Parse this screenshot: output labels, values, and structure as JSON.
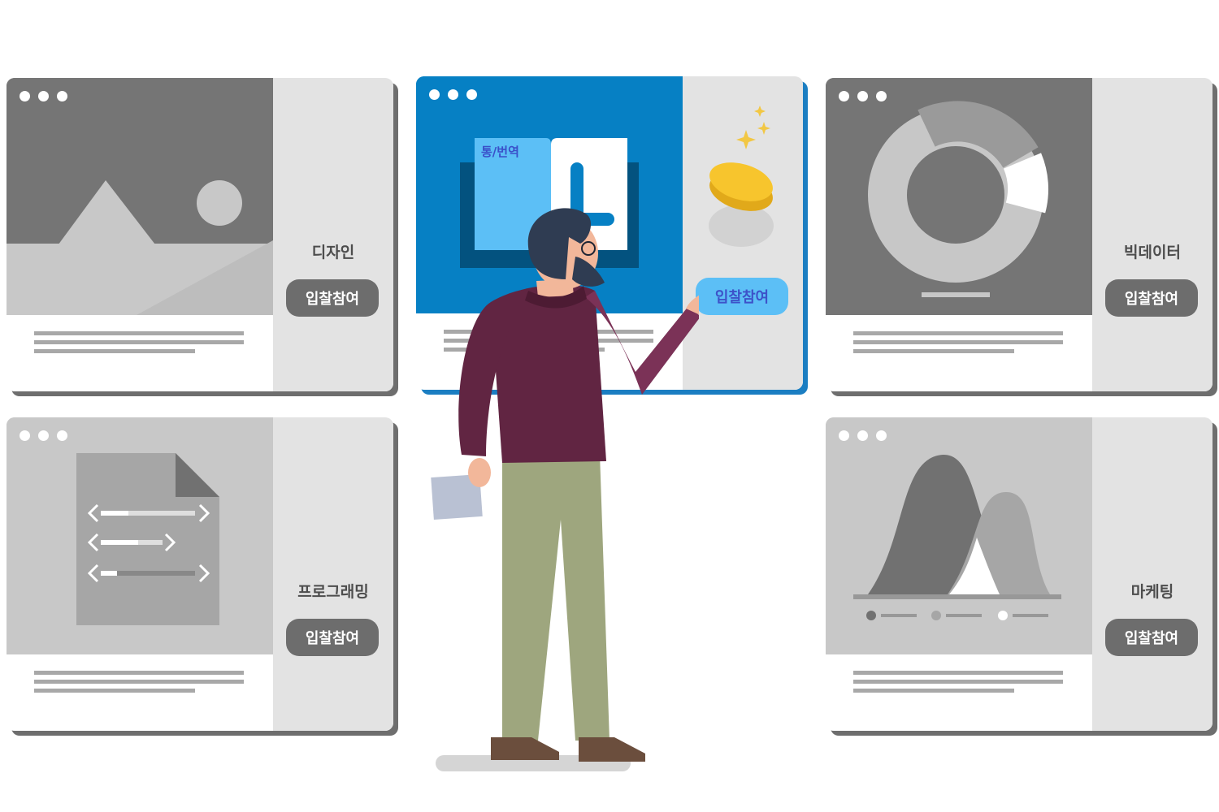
{
  "cards": [
    {
      "category": "디자인",
      "bid_label": "입찰참여",
      "hero_icon": "landscape-image-icon"
    },
    {
      "category": "",
      "book_tab": "통/번역",
      "bid_label": "입찰참여",
      "hero_icon": "open-book-icon"
    },
    {
      "category": "빅데이터",
      "bid_label": "입찰참여",
      "hero_icon": "donut-chart-icon"
    },
    {
      "category": "프로그래밍",
      "bid_label": "입찰참여",
      "hero_icon": "code-document-icon"
    },
    {
      "category": "마케팅",
      "bid_label": "입찰참여",
      "hero_icon": "bell-curve-chart-icon"
    }
  ],
  "colors": {
    "active_blue": "#0680c4",
    "active_button": "#5cbff6",
    "inactive_button": "#6d6d6d",
    "card_side": "#e3e3e3",
    "coin": "#f7c52d",
    "sweater": "#612542",
    "pants": "#9ea67e"
  },
  "illustration": {
    "figure": "man-pointing-illustration",
    "props": [
      "gold-coin-icon",
      "sparkle-icon",
      "paper-sheet-icon"
    ]
  }
}
